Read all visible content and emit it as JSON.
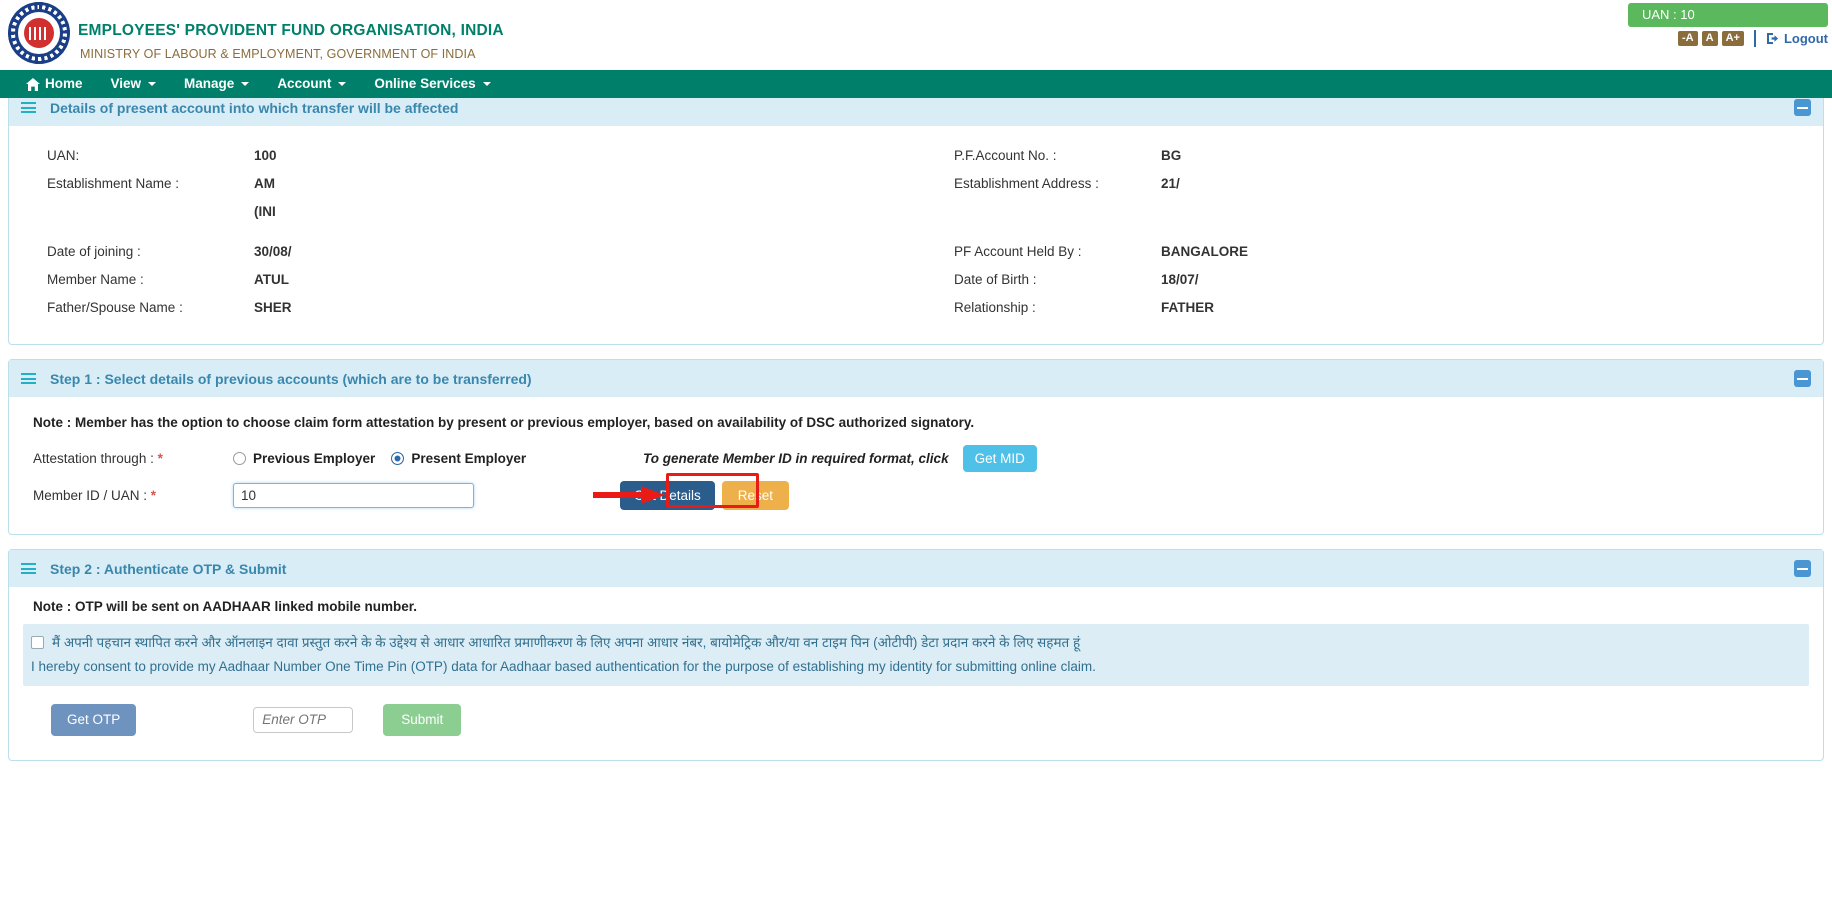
{
  "header": {
    "org_title": "EMPLOYEES' PROVIDENT FUND ORGANISATION, INDIA",
    "org_subtitle": "MINISTRY OF LABOUR & EMPLOYMENT, GOVERNMENT OF INDIA",
    "uan_badge": "UAN : 10",
    "font_decrease": "-A",
    "font_normal": "A",
    "font_increase": "A+",
    "logout": "Logout",
    "accent_teal": "#00806a",
    "badge_green": "#5cb85c",
    "link_blue": "#2f6aa8"
  },
  "nav": {
    "items": [
      {
        "label": "Home",
        "caret": false,
        "icon": "home-icon"
      },
      {
        "label": "View",
        "caret": true
      },
      {
        "label": "Manage",
        "caret": true
      },
      {
        "label": "Account",
        "caret": true
      },
      {
        "label": "Online Services",
        "caret": true
      }
    ]
  },
  "present_account": {
    "title": "Details of present account into which transfer will be affected",
    "rows": [
      {
        "l1": "UAN:",
        "v1": "100",
        "l2": "P.F.Account No. :",
        "v2": "BG"
      },
      {
        "l1": "Establishment Name :",
        "v1": "AM",
        "l2": "Establishment Address :",
        "v2": "21/"
      },
      {
        "l1": "",
        "v1": "(INI",
        "l2": "",
        "v2": ""
      },
      {
        "l1": "Date of joining :",
        "v1": "30/08/",
        "l2": "PF Account Held By :",
        "v2": "BANGALORE"
      },
      {
        "l1": "Member Name :",
        "v1": "ATUL",
        "l2": "Date of Birth :",
        "v2": "18/07/"
      },
      {
        "l1": "Father/Spouse Name :",
        "v1": "SHER",
        "l2": "Relationship :",
        "v2": "FATHER"
      }
    ]
  },
  "step1": {
    "title": "Step 1 : Select details of previous accounts (which are to be transferred)",
    "note": "Note : Member has the option to choose claim form attestation by present or previous employer, based on availability of DSC authorized signatory.",
    "attestation_label": "Attestation through :",
    "radio_previous": "Previous Employer",
    "radio_present": "Present Employer",
    "selected_radio": "Present Employer",
    "mid_hint": "To generate Member ID in required format, click",
    "get_mid_label": "Get MID",
    "member_id_label": "Member ID / UAN :",
    "member_id_value": "10",
    "get_details_label": "Get Details",
    "reset_label": "Reset",
    "highlight_color": "#e81b16"
  },
  "step2": {
    "title": "Step 2 : Authenticate OTP & Submit",
    "note": "Note : OTP will be sent on AADHAAR linked mobile number.",
    "consent_hindi": "मैं अपनी पहचान स्थापित करने और ऑनलाइन दावा प्रस्तुत करने के के उद्देश्य से आधार आधारित प्रमाणीकरण के लिए अपना आधार नंबर, बायोमेट्रिक और/या वन टाइम पिन (ओटीपी) डेटा प्रदान करने के लिए सहमत हूं",
    "consent_english": "I hereby consent to provide my Aadhaar Number One Time Pin (OTP) data for Aadhaar based authentication for the purpose of establishing my identity for submitting online claim.",
    "consent_checked": false,
    "get_otp_label": "Get OTP",
    "otp_placeholder": "Enter OTP",
    "otp_value": "",
    "submit_label": "Submit"
  }
}
